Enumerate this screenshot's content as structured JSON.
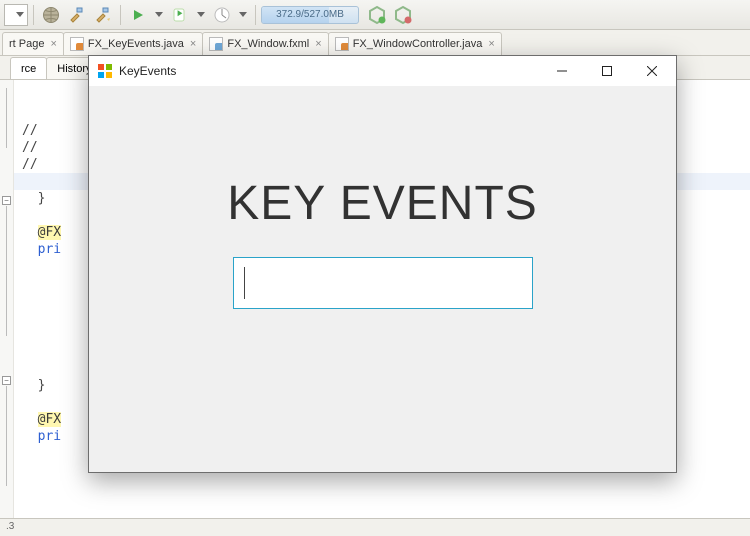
{
  "toolbar": {
    "memory_label": "372.9/527.0MB"
  },
  "tabs": [
    {
      "label": "rt Page",
      "kind": "page"
    },
    {
      "label": "FX_KeyEvents.java",
      "kind": "java"
    },
    {
      "label": "FX_Window.fxml",
      "kind": "fxml"
    },
    {
      "label": "FX_WindowController.java",
      "kind": "java"
    }
  ],
  "subtabs": {
    "source": "rce",
    "history": "History"
  },
  "code": {
    "c1": "//",
    "c2": "//",
    "c3": "//",
    "brace1": "}",
    "ann1": "@FX",
    "pri1": "pri",
    "brace2": "}",
    "ann2": "@FX",
    "pri2": "pri"
  },
  "footer": {
    "text": ".3"
  },
  "app": {
    "title": "KeyEvents",
    "heading": "KEY EVENTS",
    "textfield_value": ""
  }
}
